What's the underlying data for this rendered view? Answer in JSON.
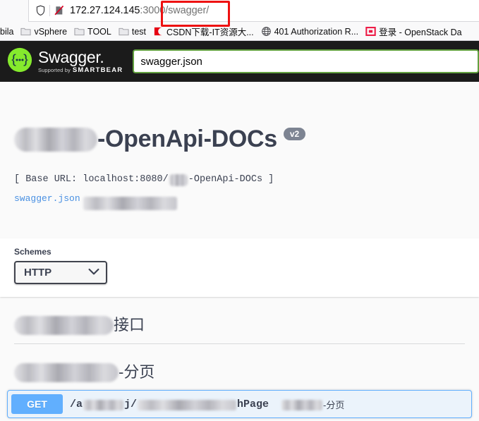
{
  "browser": {
    "url": {
      "host": "172.27.124.145",
      "port": ":3000",
      "path": "/swagger/"
    },
    "icons": {
      "shield": "shield-icon",
      "tracking_protection": "crossed-page-icon"
    },
    "bookmarks": [
      {
        "label": "bila",
        "icon": "partial-bookmark",
        "truncated_left": true
      },
      {
        "label": "vSphere",
        "icon": "folder-icon"
      },
      {
        "label": "TOOL",
        "icon": "folder-icon"
      },
      {
        "label": "test",
        "icon": "folder-icon"
      },
      {
        "label": "CSDN下载-IT资源大...",
        "icon": "csdn-icon"
      },
      {
        "label": "401 Authorization R...",
        "icon": "globe-icon"
      },
      {
        "label": "登录 - OpenStack Da",
        "icon": "openstack-icon"
      }
    ],
    "annotation": {
      "shape": "rectangle",
      "color": "#ee1111",
      "targets": "/swagger/"
    }
  },
  "topbar": {
    "logo_text": "Swagger",
    "logo_dot": ".",
    "supported_by": "Supported by",
    "brand": "SMARTBEAR",
    "download_url_value": "swagger.json",
    "download_url_placeholder": "swagger.json",
    "border_color": "#62a03f"
  },
  "info": {
    "title_suffix": "-OpenApi-DOCs",
    "title_redacted_prefix": true,
    "version_badge": "v2",
    "base_url_prefix": "[ Base URL: localhost:8080/",
    "base_url_suffix": "-OpenApi-DOCs ]",
    "swagger_json_link": "swagger.json",
    "description_redacted": true
  },
  "schemes": {
    "title": "Schemes",
    "selected": "HTTP",
    "options": [
      "HTTP"
    ],
    "caret_icon": "chevron-down-icon"
  },
  "tags": [
    {
      "id": "tag-1",
      "label_suffix": "接口",
      "redacted_prefix": true
    },
    {
      "id": "tag-2",
      "label_suffix": "-分页",
      "redacted_prefix": true
    }
  ],
  "operations": [
    {
      "method": "GET",
      "method_color": "#61affe",
      "path_part_1": "/a",
      "path_part_2": "j/",
      "path_part_3": "hPage",
      "description_suffix": "-分页"
    }
  ]
}
